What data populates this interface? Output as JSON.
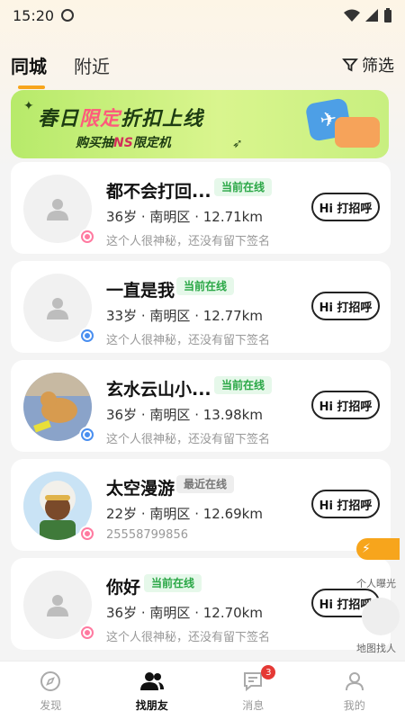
{
  "status_bar": {
    "time": "15:20"
  },
  "tabs": [
    {
      "label": "同城",
      "active": true
    },
    {
      "label": "附近",
      "active": false
    }
  ],
  "filter": {
    "label": "筛选",
    "icon": "filter-icon"
  },
  "banner": {
    "title_part1": "春日",
    "title_highlight": "限定",
    "title_part2": "折扣上线",
    "subtitle_part1": "购买抽",
    "subtitle_highlight": "NS",
    "subtitle_part2": "限定机"
  },
  "users": [
    {
      "name": "都不会打回...",
      "status": "当前在线",
      "status_type": "now",
      "age": "36岁",
      "district": "南明区",
      "distance": "12.71km",
      "sign": "这个人很神秘，还没有留下签名",
      "gender": "female",
      "avatar": "default"
    },
    {
      "name": "一直是我",
      "status": "当前在线",
      "status_type": "now",
      "age": "33岁",
      "district": "南明区",
      "distance": "12.77km",
      "sign": "这个人很神秘，还没有留下签名",
      "gender": "male",
      "avatar": "default"
    },
    {
      "name": "玄水云山小...",
      "status": "当前在线",
      "status_type": "now",
      "age": "36岁",
      "district": "南明区",
      "distance": "13.98km",
      "sign": "这个人很神秘，还没有留下签名",
      "gender": "male",
      "avatar": "dog-photo"
    },
    {
      "name": "太空漫游",
      "status": "最近在线",
      "status_type": "recent",
      "age": "22岁",
      "district": "南明区",
      "distance": "12.69km",
      "sign": "25558799856",
      "gender": "female",
      "avatar": "cartoon"
    },
    {
      "name": "你好",
      "status": "当前在线",
      "status_type": "now",
      "age": "36岁",
      "district": "南明区",
      "distance": "12.70km",
      "sign": "这个人很神秘，还没有留下签名",
      "gender": "female",
      "avatar": "default"
    }
  ],
  "hi_button": "Hi 打招呼",
  "float": {
    "exposure": "个人曝光",
    "map": "地图找人"
  },
  "bottom_nav": [
    {
      "label": "发现",
      "icon": "compass-icon",
      "active": false
    },
    {
      "label": "找朋友",
      "icon": "friends-icon",
      "active": true
    },
    {
      "label": "消息",
      "icon": "message-icon",
      "active": false,
      "badge": "3"
    },
    {
      "label": "我的",
      "icon": "profile-icon",
      "active": false
    }
  ],
  "colors": {
    "accent": "#f7a51c",
    "online": "#2aa746",
    "badge": "#e53935"
  }
}
